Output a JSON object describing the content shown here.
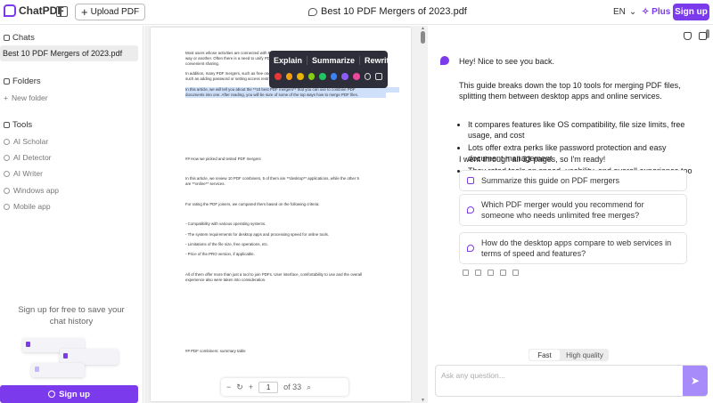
{
  "app": {
    "logo_text": "ChatPDF",
    "upload_label": "Upload PDF",
    "doc_title": "Best 10 PDF Mergers of 2023.pdf",
    "lang": "EN",
    "plus_label": "Plus",
    "signup_label": "Sign up",
    "brand_color": "#7c3aed"
  },
  "sidebar": {
    "chats_title": "Chats",
    "chat_item": "Best 10 PDF Mergers of 2023.pdf",
    "folders_title": "Folders",
    "new_folder": "New folder",
    "tools_title": "Tools",
    "tools": [
      "AI Scholar",
      "AI Detector",
      "AI Writer",
      "Windows app",
      "Mobile app"
    ],
    "promo_text": "Sign up for free to save your chat history",
    "signup_label": "Sign up"
  },
  "document": {
    "lines": [
      "Most users whose activities are connected with PDF files will need to merge PDF documents in one",
      "way or another. Often there is a need to unify PDFs for archiving, printing, or more",
      "convenient sharing.",
      "In addition, many PDF mergers, such as free ones, provide extra features,",
      "such as adding password or setting access restrictions.",
      "In this article, we will tell you about the **10 best PDF mergers** that you can use to combine PDF",
      "documents into one. After reading, you will be sure of some of the top ways how to merge PDF files.",
      "## How we picked and tested PDF mergers",
      "In this article, we review 10 PDF combiners, 5 of them are **desktop** applications, while the other 5",
      "are **online** services.",
      "For rating the PDF joiners, we compared them based on the following criteria:",
      "- Compatibility with various operating systems.",
      "- The system requirements for desktop apps and processing speed for online tools.",
      "- Limitations of the file size, free operations, etc.",
      "- Price of the PRO version, if applicable.",
      "All of them offer more than just a tool to join PDFs. User interface, comfortability to use and the overall",
      "experience also were taken into consideration.",
      "## PDF combiners: summary table"
    ],
    "context_menu": {
      "actions": [
        "Explain",
        "Summarize",
        "Rewrite"
      ],
      "colors": [
        "#e53935",
        "#f59e0b",
        "#eab308",
        "#84cc16",
        "#22c55e",
        "#3b82f6",
        "#8b5cf6",
        "#ec4899"
      ]
    },
    "pager": {
      "current_page": "1",
      "total": "of 33"
    }
  },
  "chat": {
    "greeting": "Hey! Nice to see you back.",
    "intro": "This guide breaks down the top 10 tools for merging PDF files, splitting them between desktop apps and online services.",
    "bullets": [
      "It compares features like OS compatibility, file size limits, free usage, and cost",
      "Lots offer extra perks like password protection and easy document management",
      "They rated tools on speed, usability, and overall experience too"
    ],
    "pages_note": "I went through all 33 pages, so I'm ready!",
    "suggestions": [
      "Summarize this guide on PDF mergers",
      "Which PDF merger would you recommend for someone who needs unlimited free merges?",
      "How do the desktop apps compare to web services in terms of speed and features?"
    ],
    "mode_fast": "Fast",
    "mode_hq": "High quality",
    "input_placeholder": "Ask any question..."
  }
}
